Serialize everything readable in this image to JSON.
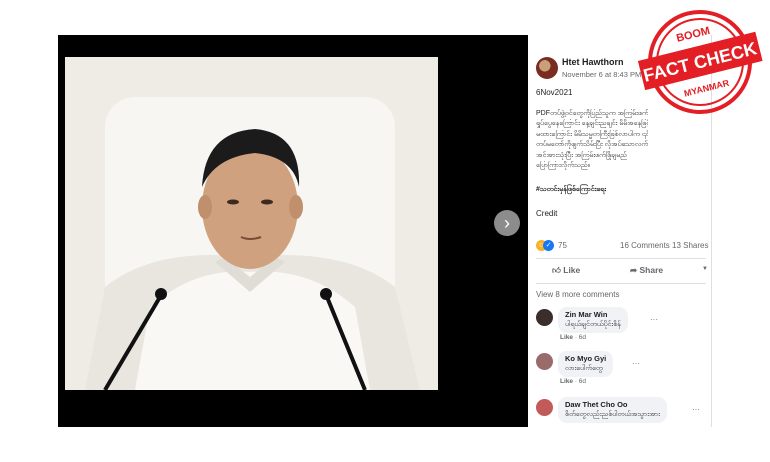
{
  "post": {
    "author": "Htet Hawthorn",
    "timestamp": "November 6 at 8:43 PM · ",
    "date_line": "6Nov2021",
    "text_lines": [
      "PDFတပ်ဖွဲ့ဝင်တွေကိုပြည်သူက အကြမ်းဖက်",
      "ရှုပ်ပွေနေကြောင်း နေ့ချင်းညချင်း မိမိအနေဖြင့် ထုတ်",
      "မထားကြောင်း မိမိသမ္မတကြီးဖြစ်လာပါက ၎င်းတို့ကို",
      "တပ်မတော်ကိုဖျက်သိမ်းပြီး လိုအပ်သောလက်ရုံးရည်",
      "အင်အားသုံးပြီး အကြမ်းဖက်ဖြိုချမည်",
      "ပြောကြားလိုက်သည်။"
    ],
    "hashtag": "#သတင်းမှန်ဖြစ်ကြောင်းရေး",
    "credit": "Credit",
    "reaction_count": "75",
    "comments_count": "16 Comments",
    "shares_count": "13 Shares",
    "like_label": "Like",
    "share_label": "Share",
    "view_more": "View 8 more comments",
    "next_arrow": "›",
    "dropdown_glyph": "▼",
    "more_glyph": "···"
  },
  "comments": [
    {
      "name": "Zin Mar Win",
      "text": "ပါရယ်ချင်တယ်ပိုင်းစိန်",
      "like": "Like",
      "age": "6d"
    },
    {
      "name": "Ko Myo Gyi",
      "text": "လားပေါက်တွေ",
      "like": "Like",
      "age": "6d"
    },
    {
      "name": "Daw Thet Cho Oo",
      "text": "စိတ်တွေလည်းညစ်ပါတယ်အသွားအား",
      "like": "Like",
      "age": ""
    }
  ],
  "badge": {
    "top": "BOOM",
    "main": "FACT CHECK",
    "bottom": "MYANMAR",
    "color": "#e31e24"
  }
}
